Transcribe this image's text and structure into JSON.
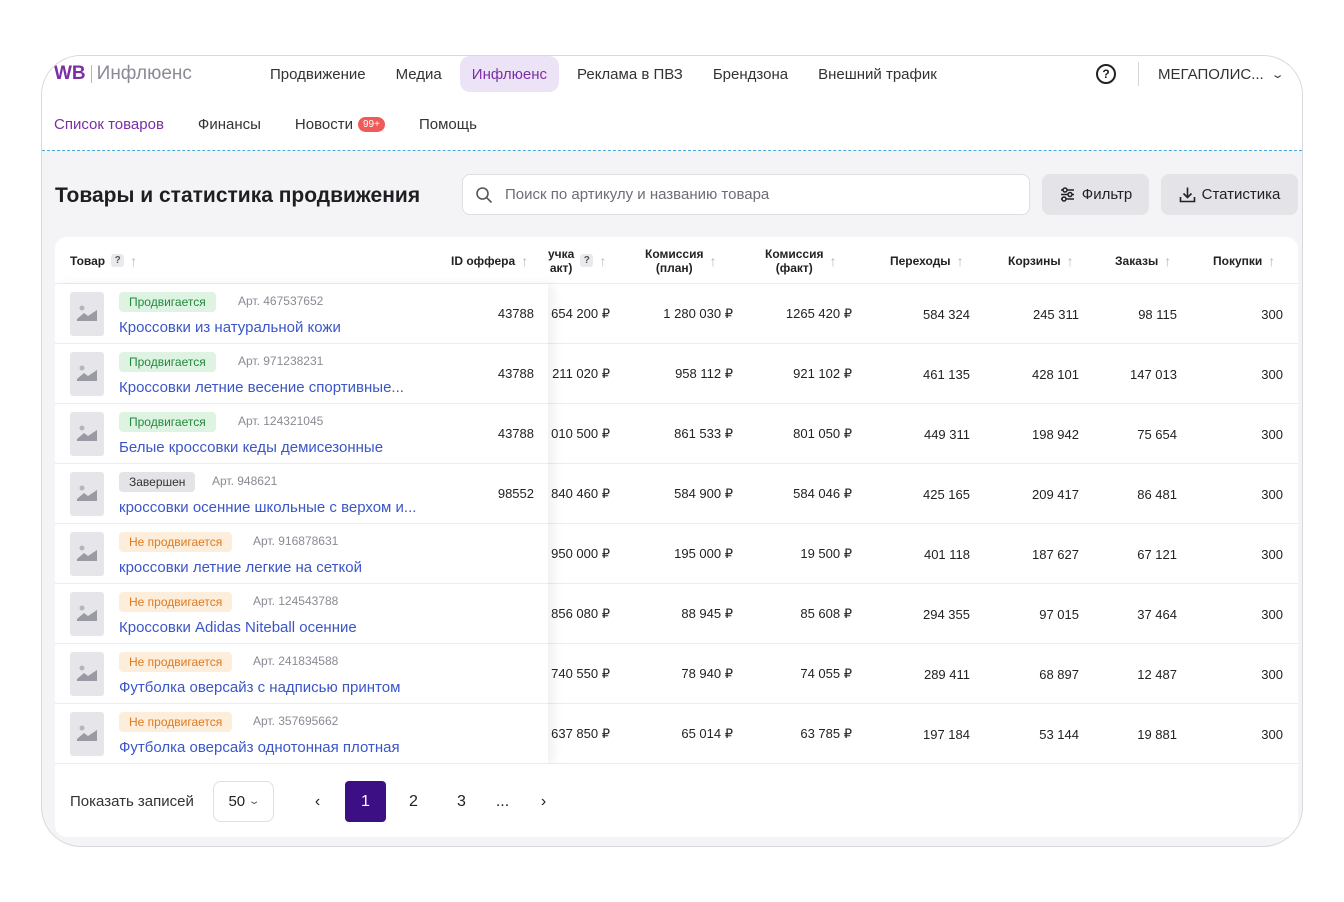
{
  "logo": {
    "brand": "WB",
    "product": "Инфлюенс"
  },
  "nav": [
    {
      "label": "Продвижение"
    },
    {
      "label": "Медиа"
    },
    {
      "label": "Инфлюенс"
    },
    {
      "label": "Реклама в ПВЗ"
    },
    {
      "label": "Брендзона"
    },
    {
      "label": "Внешний трафик"
    }
  ],
  "help_label": "?",
  "account": "МЕГАПОЛИС...",
  "subnav": [
    {
      "label": "Список товаров"
    },
    {
      "label": "Финансы"
    },
    {
      "label": "Новости",
      "badge": "99+"
    },
    {
      "label": "Помощь"
    }
  ],
  "page_title": "Товары и статистика продвижения",
  "search": {
    "placeholder": "Поиск по артикулу и названию товара"
  },
  "buttons": {
    "filter": "Фильтр",
    "stats": "Статистика"
  },
  "colors": {
    "accent": "#7b2ea8",
    "active_page": "#3d0f85",
    "link": "#3b56c9",
    "promo": "#1f8a3a",
    "not_promo": "#e0791f"
  },
  "table": {
    "headers": {
      "product": "Товар",
      "offer": "ID оффера",
      "revenue_l1": "учка",
      "revenue_l2": "акт)",
      "comm_plan_l1": "Комиссия",
      "comm_plan_l2": "(план)",
      "comm_fact_l1": "Комиссия",
      "comm_fact_l2": "(факт)",
      "clicks": "Переходы",
      "carts": "Корзины",
      "orders": "Заказы",
      "purchases": "Покупки",
      "hint": "?"
    },
    "rows": [
      {
        "status": "Продвигается",
        "status_type": "promo",
        "art": "Арт. 467537652",
        "name": "Кроссовки из натуральной кожи",
        "offer": "43788",
        "revenue": "654 200 ₽",
        "comm_plan": "1 280 030 ₽",
        "comm_fact": "1265 420 ₽",
        "clicks": "584 324",
        "carts": "245 311",
        "orders": "98 115",
        "purchases": "300"
      },
      {
        "status": "Продвигается",
        "status_type": "promo",
        "art": "Арт. 971238231",
        "name": "Кроссовки летние весение спортивные...",
        "offer": "43788",
        "revenue": ") 211 020 ₽",
        "comm_plan": "958 112 ₽",
        "comm_fact": "921 102 ₽",
        "clicks": "461 135",
        "carts": "428 101",
        "orders": "147 013",
        "purchases": "300"
      },
      {
        "status": "Продвигается",
        "status_type": "promo",
        "art": "Арт. 124321045",
        "name": "Белые кроссовки кеды демисезонные",
        "offer": "43788",
        "revenue": "010 500 ₽",
        "comm_plan": "861 533 ₽",
        "comm_fact": "801 050 ₽",
        "clicks": "449 311",
        "carts": "198 942",
        "orders": "75 654",
        "purchases": "300"
      },
      {
        "status": "Завершен",
        "status_type": "done",
        "art": "Арт. 948621",
        "name": "кроссовки осенние школьные с верхом и...",
        "offer": "98552",
        "revenue": "840 460 ₽",
        "comm_plan": "584 900 ₽",
        "comm_fact": "584 046 ₽",
        "clicks": "425 165",
        "carts": "209 417",
        "orders": "86 481",
        "purchases": "300"
      },
      {
        "status": "Не продвигается",
        "status_type": "notpromo",
        "art": "Арт. 916878631",
        "name": "кроссовки летние легкие на сеткой",
        "offer": "",
        "revenue": "950 000 ₽",
        "comm_plan": "195 000 ₽",
        "comm_fact": "19 500 ₽",
        "clicks": "401 118",
        "carts": "187 627",
        "orders": "67 121",
        "purchases": "300"
      },
      {
        "status": "Не продвигается",
        "status_type": "notpromo",
        "art": "Арт. 124543788",
        "name": "Кроссовки Adidas Niteball осенние",
        "offer": "",
        "revenue": "856 080 ₽",
        "comm_plan": "88 945 ₽",
        "comm_fact": "85 608 ₽",
        "clicks": "294 355",
        "carts": "97 015",
        "orders": "37 464",
        "purchases": "300"
      },
      {
        "status": "Не продвигается",
        "status_type": "notpromo",
        "art": "Арт. 241834588",
        "name": "Футболка оверсайз с надписью принтом",
        "offer": "",
        "revenue": "740 550 ₽",
        "comm_plan": "78 940 ₽",
        "comm_fact": "74 055 ₽",
        "clicks": "289 411",
        "carts": "68 897",
        "orders": "12 487",
        "purchases": "300"
      },
      {
        "status": "Не продвигается",
        "status_type": "notpromo",
        "art": "Арт. 357695662",
        "name": "Футболка оверсайз однотонная плотная",
        "offer": "",
        "revenue": "637 850 ₽",
        "comm_plan": "65 014 ₽",
        "comm_fact": "63 785 ₽",
        "clicks": "197 184",
        "carts": "53 144",
        "orders": "19 881",
        "purchases": "300"
      }
    ]
  },
  "pagination": {
    "show_label": "Показать записей",
    "per_page": "50",
    "pages": [
      "1",
      "2",
      "3",
      "..."
    ],
    "active": "1"
  }
}
